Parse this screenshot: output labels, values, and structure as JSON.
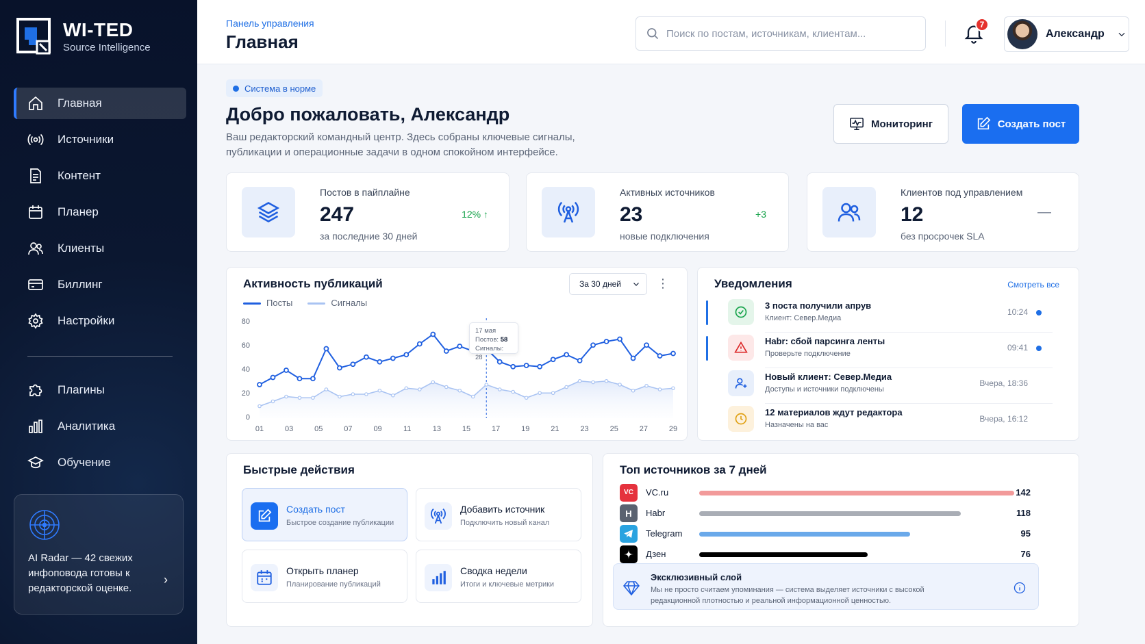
{
  "brand": {
    "name": "WI-TED",
    "tagline": "Source Intelligence"
  },
  "sidebar": {
    "items": [
      {
        "label": "Главная",
        "icon": "home-icon",
        "active": true
      },
      {
        "label": "Источники",
        "icon": "broadcast-icon"
      },
      {
        "label": "Контент",
        "icon": "document-icon"
      },
      {
        "label": "Планер",
        "icon": "calendar-icon"
      },
      {
        "label": "Клиенты",
        "icon": "users-icon"
      },
      {
        "label": "Биллинг",
        "icon": "card-icon"
      },
      {
        "label": "Настройки",
        "icon": "gear-icon"
      }
    ],
    "secondary": [
      {
        "label": "Плагины",
        "icon": "puzzle-icon"
      },
      {
        "label": "Аналитика",
        "icon": "bar-chart-icon"
      },
      {
        "label": "Обучение",
        "icon": "graduation-icon"
      }
    ],
    "radar": {
      "text": "AI Radar — 42 свежих инфоповода готовы к редакторской оценке."
    }
  },
  "header": {
    "breadcrumb": "Панель управления",
    "title": "Главная",
    "search_placeholder": "Поиск по постам, источникам, клиентам...",
    "notifications_count": "7",
    "user_name": "Александр"
  },
  "welcome": {
    "status": "Система в норме",
    "title": "Добро пожаловать, Александр",
    "subtitle": "Ваш редакторский командный центр. Здесь собраны ключевые сигналы, публикации и операционные задачи в одном спокойном интерфейсе.",
    "monitor_button": "Мониторинг",
    "create_button": "Создать пост"
  },
  "stats": [
    {
      "label": "Постов в пайплайне",
      "value": "247",
      "sub": "за последние 30 дней",
      "delta": "12% ↑",
      "delta_color": "#16a34a"
    },
    {
      "label": "Активных источников",
      "value": "23",
      "sub": "новые подключения",
      "delta": "+3",
      "delta_color": "#16a34a"
    },
    {
      "label": "Клиентов под управлением",
      "value": "12",
      "sub": "без просрочек SLA",
      "delta": "—",
      "delta_color": "#7b8496"
    }
  ],
  "activity": {
    "title": "Активность публикаций",
    "range": "За 30 дней",
    "tooltip": {
      "date": "17 мая",
      "posts_label": "Постов:",
      "posts": "58",
      "signals_label": "Сигналы:",
      "signals": "28"
    }
  },
  "chart_data": {
    "type": "line",
    "title": "Активность публикаций",
    "x": [
      1,
      2,
      3,
      4,
      5,
      6,
      7,
      8,
      9,
      10,
      11,
      12,
      13,
      14,
      15,
      16,
      17,
      18,
      19,
      20,
      21,
      22,
      23,
      24,
      25,
      26,
      27,
      28,
      29,
      30
    ],
    "x_tick_labels": [
      "01",
      "03",
      "05",
      "07",
      "09",
      "11",
      "13",
      "15",
      "17",
      "19",
      "21",
      "23",
      "25",
      "27",
      "29"
    ],
    "ylim": [
      0,
      80
    ],
    "y_ticks": [
      0,
      20,
      40,
      60,
      80
    ],
    "series": [
      {
        "name": "Посты",
        "color": "#1f5fe0",
        "values": [
          28,
          34,
          40,
          33,
          33,
          58,
          42,
          45,
          51,
          47,
          50,
          53,
          62,
          70,
          56,
          60,
          56,
          58,
          47,
          43,
          44,
          43,
          49,
          53,
          48,
          61,
          64,
          66,
          50,
          61,
          52,
          54
        ]
      },
      {
        "name": "Сигналы",
        "color": "#a9c3f2",
        "values": [
          10,
          14,
          18,
          17,
          17,
          24,
          18,
          20,
          20,
          23,
          19,
          25,
          24,
          30,
          26,
          23,
          18,
          28,
          24,
          22,
          17,
          21,
          21,
          26,
          31,
          30,
          31,
          28,
          23,
          27,
          24,
          25
        ]
      }
    ],
    "highlight_index": 17,
    "grid": false,
    "legend": "top-left"
  },
  "notifications": {
    "title": "Уведомления",
    "see_all": "Смотреть все",
    "items": [
      {
        "title": "3 поста получили апрув",
        "sub": "Клиент: Север.Медиа",
        "time": "10:24",
        "icon": "check-circle-icon",
        "unread": true
      },
      {
        "title": "Habr: сбой парсинга ленты",
        "sub": "Проверьте подключение",
        "time": "09:41",
        "icon": "warning-icon",
        "unread": true
      },
      {
        "title": "Новый клиент: Север.Медиа",
        "sub": "Доступы и источники подключены",
        "time": "Вчера, 18:36",
        "icon": "user-plus-icon",
        "unread": false
      },
      {
        "title": "12 материалов ждут редактора",
        "sub": "Назначены на вас",
        "time": "Вчера, 16:12",
        "icon": "clock-icon",
        "unread": false
      }
    ]
  },
  "quick_actions": {
    "title": "Быстрые действия",
    "items": [
      {
        "title": "Создать пост",
        "sub": "Быстрое создание публикации",
        "icon": "edit-icon"
      },
      {
        "title": "Добавить источник",
        "sub": "Подключить новый канал",
        "icon": "antenna-icon"
      },
      {
        "title": "Открыть планер",
        "sub": "Планирование публикаций",
        "icon": "calendar-icon"
      },
      {
        "title": "Сводка недели",
        "sub": "Итоги и ключевые метрики",
        "icon": "bar-chart-icon"
      }
    ]
  },
  "top_sources": {
    "title": "Топ источников за 7 дней",
    "items": [
      {
        "name": "VC.ru",
        "logo": "vc",
        "value": 142,
        "color": "#f29a9a",
        "logo_color": "#e5323d"
      },
      {
        "name": "Habr",
        "logo": "H",
        "value": 118,
        "color": "#a9adb5",
        "logo_color": "#5a6270"
      },
      {
        "name": "Telegram",
        "logo": "tg",
        "value": 95,
        "color": "#6aa9ea",
        "logo_color": "#2aa3e0"
      },
      {
        "name": "Дзен",
        "logo": "zen",
        "value": 76,
        "color": "#000000",
        "logo_color": "#000000"
      }
    ],
    "exclusive": {
      "title": "Эксклюзивный слой",
      "text": "Мы не просто считаем упоминания — система выделяет источники с высокой редакционной плотностью и реальной информационной ценностью."
    }
  }
}
